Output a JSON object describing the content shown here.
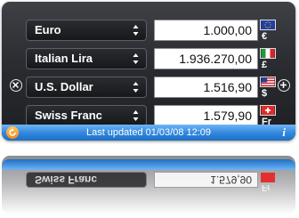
{
  "converter": {
    "rows": [
      {
        "currency": "Euro",
        "value": "1.000,00",
        "symbol": "€",
        "flag": "eu-flag"
      },
      {
        "currency": "Italian Lira",
        "value": "1.936.270,00",
        "symbol": "£",
        "flag": "it-flag"
      },
      {
        "currency": "U.S. Dollar",
        "value": "1.516,90",
        "symbol": "$",
        "flag": "us-flag"
      },
      {
        "currency": "Swiss Franc",
        "value": "1.579,90",
        "symbol": "Fr",
        "flag": "ch-flag"
      }
    ],
    "remove_icon": "minus-circle-icon",
    "add_icon": "plus-circle-icon"
  },
  "footer": {
    "status": "Last updated 01/03/08 12:09",
    "info_label": "i",
    "refresh_icon": "refresh-icon"
  },
  "colors": {
    "widget_background": "#2a2c31",
    "footer_blue": "#2f86dc",
    "refresh_orange": "#f08c12"
  }
}
